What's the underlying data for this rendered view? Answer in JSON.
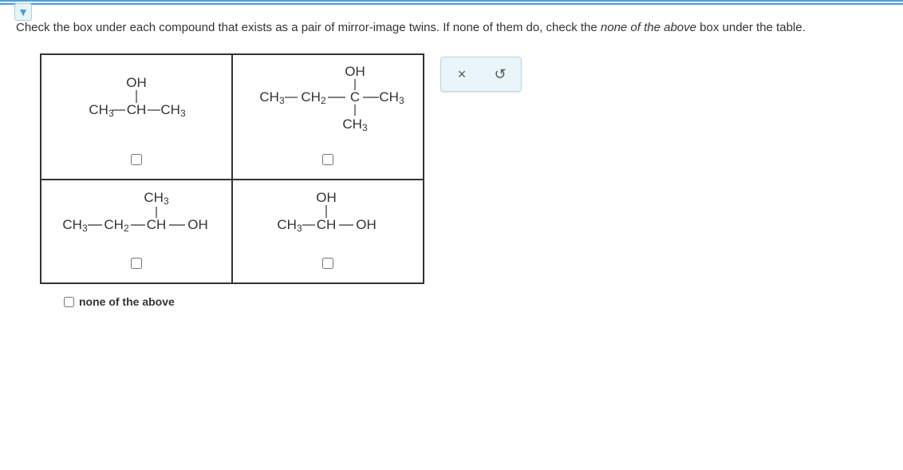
{
  "instruction_pre": "Check the box under each compound that exists as a pair of mirror-image twins. If none of them do, check the ",
  "instruction_em": "none of the above",
  "instruction_post": " box under the table.",
  "compounds": {
    "c1": {
      "top": "OH",
      "main": "CH₃—CH—CH₃"
    },
    "c2": {
      "top": "OH",
      "main": "CH₃—CH₂—C—CH₃",
      "bottom": "CH₃"
    },
    "c3": {
      "top": "CH₃",
      "main": "CH₃—CH₂—CH—OH"
    },
    "c4": {
      "top": "OH",
      "main": "CH₃—CH—OH"
    }
  },
  "none_label": "none of the above",
  "controls": {
    "close": "×",
    "reset": "↺"
  }
}
